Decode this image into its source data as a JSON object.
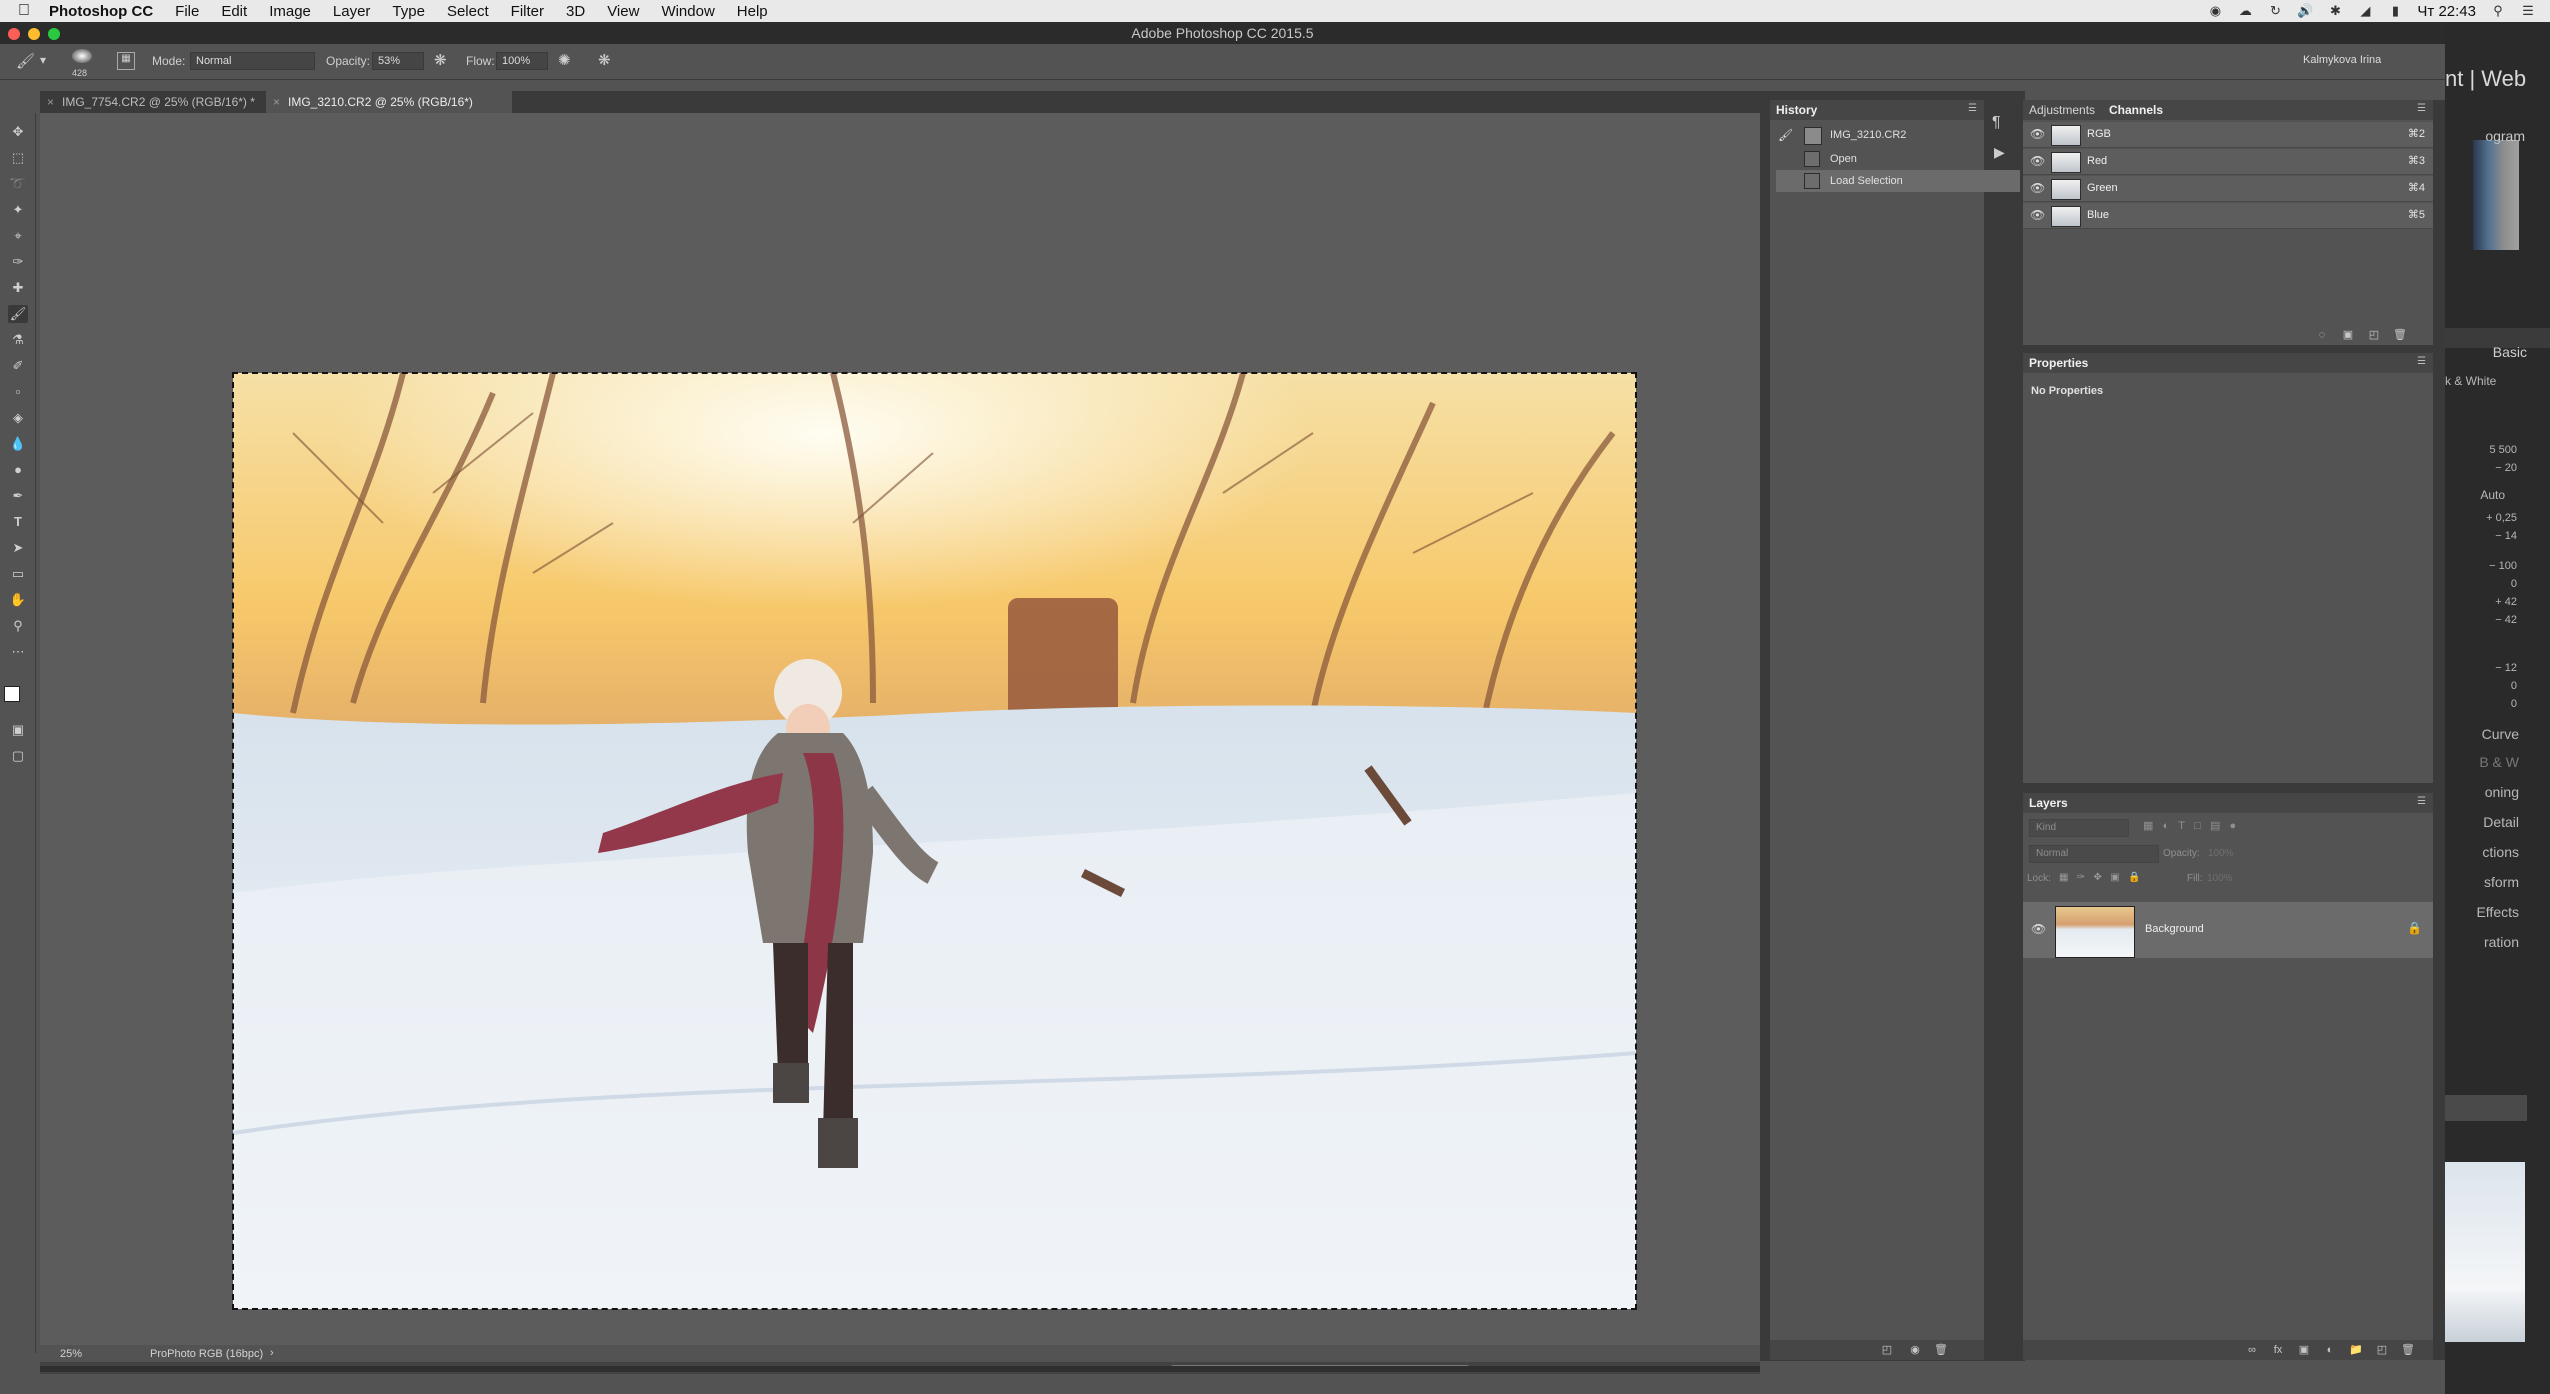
{
  "menubar": {
    "apple": "",
    "app": "Photoshop CC",
    "items": [
      "File",
      "Edit",
      "Image",
      "Layer",
      "Type",
      "Select",
      "Filter",
      "3D",
      "View",
      "Window",
      "Help"
    ],
    "clock": "Чт 22:43",
    "icons": [
      "record-icon",
      "wifi-icon",
      "volume-icon",
      "bluetooth-icon",
      "keyboard-icon",
      "battery-icon",
      "search-icon",
      "list-icon"
    ]
  },
  "window": {
    "title": "Adobe Photoshop CC 2015.5"
  },
  "options": {
    "brush_size": "428",
    "mode_label": "Mode:",
    "mode_value": "Normal",
    "opacity_label": "Opacity:",
    "opacity_value": "53%",
    "flow_label": "Flow:",
    "flow_value": "100%",
    "workspace": "Kalmykova Irina"
  },
  "tabs": [
    {
      "label": "IMG_7754.CR2 @ 25% (RGB/16*) *"
    },
    {
      "label": "IMG_3210.CR2 @ 25% (RGB/16*)"
    }
  ],
  "status": {
    "zoom": "25%",
    "profile": "ProPhoto RGB (16bpc)"
  },
  "history": {
    "title": "History",
    "snapshot": "IMG_3210.CR2",
    "states": [
      "Open",
      "Load Selection"
    ]
  },
  "channels_panel": {
    "tabs": [
      "Adjustments",
      "Channels"
    ],
    "rows": [
      {
        "name": "RGB",
        "shortcut": "⌘2"
      },
      {
        "name": "Red",
        "shortcut": "⌘3"
      },
      {
        "name": "Green",
        "shortcut": "⌘4"
      },
      {
        "name": "Blue",
        "shortcut": "⌘5"
      }
    ]
  },
  "properties": {
    "title": "Properties",
    "content": "No Properties"
  },
  "layers": {
    "title": "Layers",
    "kind_placeholder": "Kind",
    "blend": "Normal",
    "opacity_label": "Opacity:",
    "opacity_value": "100%",
    "lock_label": "Lock:",
    "fill_label": "Fill:",
    "fill_value": "100%",
    "items": [
      {
        "name": "Background"
      }
    ]
  },
  "lightroom": {
    "modules": "nt | Web",
    "histogram": "ogram",
    "basic": "Basic",
    "bw": "k & White",
    "auto": "Auto",
    "numbers": [
      "5 500",
      "− 20",
      "+ 0,25",
      "− 14",
      "− 100",
      "0",
      "+ 42",
      "− 42",
      "− 12",
      "0",
      "0"
    ],
    "sections": [
      "Curve",
      "B & W",
      "oning",
      "Detail",
      "ctions",
      "sform",
      "Effects",
      "ration"
    ]
  }
}
